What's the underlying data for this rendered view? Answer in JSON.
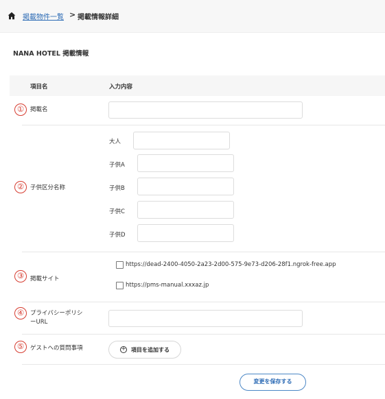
{
  "breadcrumb": {
    "link": "掲載物件一覧",
    "separator": ">",
    "current": "掲載情報詳細"
  },
  "section_title": "NANA HOTEL 掲載情報",
  "table_header": {
    "col1": "項目名",
    "col2": "入力内容"
  },
  "rows": {
    "r1": {
      "number": "①",
      "label": "掲載名",
      "value": ""
    },
    "r2": {
      "number": "②",
      "label": "子供区分名称",
      "fields": [
        {
          "label": "大人",
          "value": ""
        },
        {
          "label": "子供A",
          "value": ""
        },
        {
          "label": "子供B",
          "value": ""
        },
        {
          "label": "子供C",
          "value": ""
        },
        {
          "label": "子供D",
          "value": ""
        }
      ]
    },
    "r3": {
      "number": "③",
      "label": "掲載サイト",
      "sites": [
        {
          "url": "https://dead-2400-4050-2a23-2d00-575-9e73-d206-28f1.ngrok-free.app",
          "checked": false
        },
        {
          "url": "https://pms-manual.xxxaz.jp",
          "checked": false
        }
      ]
    },
    "r4": {
      "number": "④",
      "label_line1": "プライバシーポリシ",
      "label_line2": "ーURL",
      "value": ""
    },
    "r5": {
      "number": "⑤",
      "label": "ゲストへの質問事項",
      "add_button": "項目を追加する"
    }
  },
  "save_button": "変更を保存する",
  "colors": {
    "accent": "#2c6bb5",
    "number_red": "#d63b2f"
  },
  "icons": {
    "home": "home-icon",
    "plus": "plus-circle-icon"
  }
}
